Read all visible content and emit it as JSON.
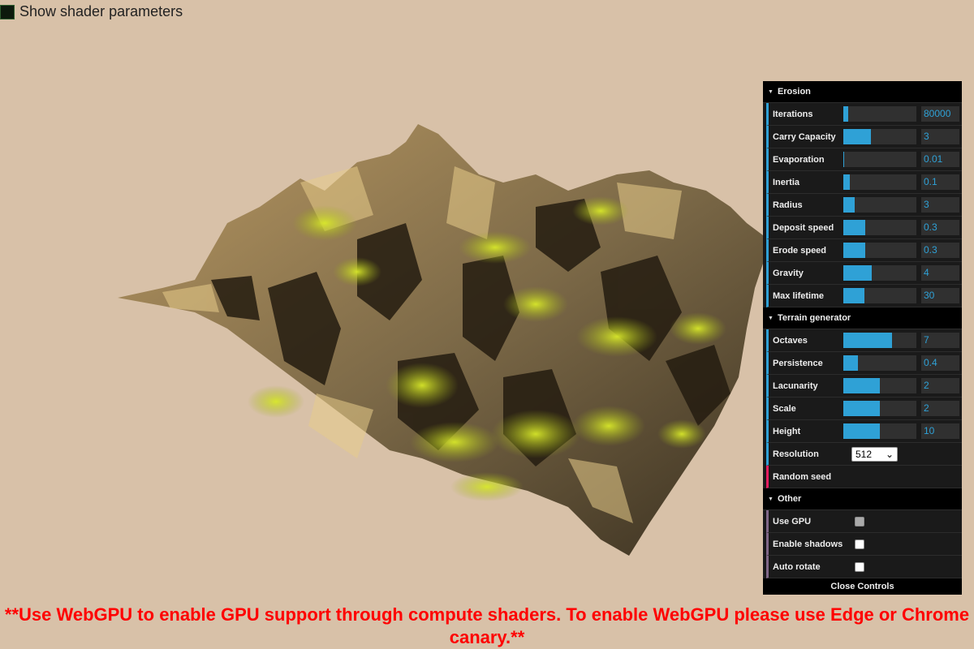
{
  "shader_toggle": {
    "label": "Show shader parameters"
  },
  "gui": {
    "folders": [
      {
        "title": "Erosion",
        "rows": [
          {
            "label": "Iterations",
            "value": "80000",
            "fill": 0.07
          },
          {
            "label": "Carry Capacity",
            "value": "3",
            "fill": 0.38
          },
          {
            "label": "Evaporation",
            "value": "0.01",
            "fill": 0.01
          },
          {
            "label": "Inertia",
            "value": "0.1",
            "fill": 0.09
          },
          {
            "label": "Radius",
            "value": "3",
            "fill": 0.16
          },
          {
            "label": "Deposit speed",
            "value": "0.3",
            "fill": 0.3
          },
          {
            "label": "Erode speed",
            "value": "0.3",
            "fill": 0.3
          },
          {
            "label": "Gravity",
            "value": "4",
            "fill": 0.39
          },
          {
            "label": "Max lifetime",
            "value": "30",
            "fill": 0.29
          }
        ]
      },
      {
        "title": "Terrain generator",
        "rows": [
          {
            "label": "Octaves",
            "value": "7",
            "fill": 0.67
          },
          {
            "label": "Persistence",
            "value": "0.4",
            "fill": 0.2
          },
          {
            "label": "Lacunarity",
            "value": "2",
            "fill": 0.5
          },
          {
            "label": "Scale",
            "value": "2",
            "fill": 0.5
          },
          {
            "label": "Height",
            "value": "10",
            "fill": 0.5
          }
        ],
        "resolution": {
          "label": "Resolution",
          "selected": "512"
        },
        "random_seed": {
          "label": "Random seed"
        }
      },
      {
        "title": "Other",
        "checks": [
          {
            "label": "Use GPU",
            "checked": false,
            "disabled": true
          },
          {
            "label": "Enable shadows",
            "checked": false,
            "disabled": false
          },
          {
            "label": "Auto rotate",
            "checked": false,
            "disabled": false
          }
        ]
      }
    ],
    "close_label": "Close Controls"
  },
  "notice": "**Use WebGPU to enable GPU support through compute shaders. To enable WebGPU please use Edge or Chrome canary.**",
  "colors": {
    "background": "#d8c1a8",
    "slider_fill": "#2fa1d6",
    "notice": "#ff0000"
  }
}
